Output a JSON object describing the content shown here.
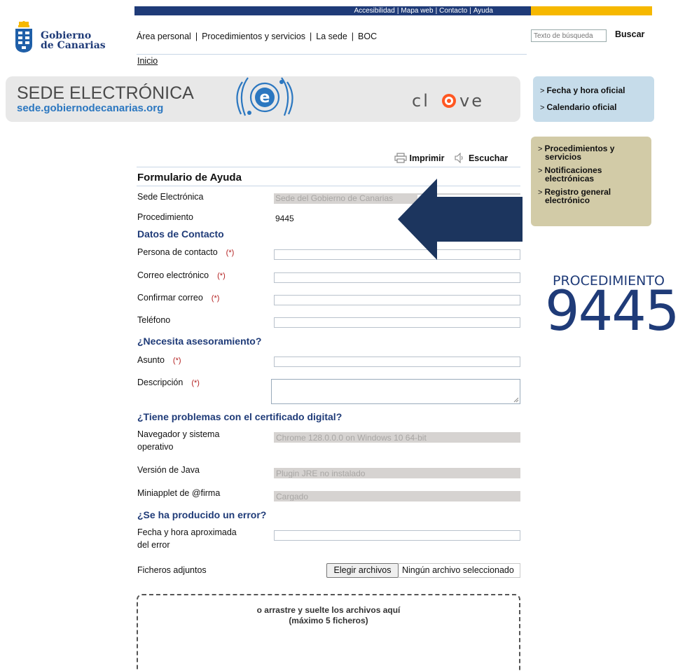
{
  "utility_bar": {
    "accesibilidad": "Accesibilidad",
    "mapa_web": "Mapa web",
    "contacto": "Contacto",
    "ayuda": "Ayuda",
    "separator": "|"
  },
  "logo": {
    "line1": "Gobierno",
    "line2": "de Canarias"
  },
  "nav": {
    "items": [
      "Área personal",
      "Procedimientos y servicios",
      "La sede",
      "BOC"
    ],
    "separator": "|",
    "breadcrumb": "Inicio"
  },
  "search": {
    "placeholder": "Texto de búsqueda",
    "button": "Buscar"
  },
  "banner": {
    "title": "SEDE ELECTRÓNICA",
    "url": "sede.gobiernodecanarias.org",
    "e_logo": "e",
    "clave_left": "cl",
    "clave_right": "ve"
  },
  "right_links_top": {
    "caret": ">",
    "items": [
      "Fecha y hora oficial",
      "Calendario oficial"
    ]
  },
  "right_links_bottom": {
    "caret": ">",
    "items": [
      [
        "Procedimientos y",
        "servicios"
      ],
      [
        "Notificaciones",
        "electrónicas"
      ],
      [
        "Registro general",
        "electrónico"
      ]
    ]
  },
  "tools": {
    "print": "Imprimir",
    "listen": "Escuchar"
  },
  "form": {
    "title": "Formulario de Ayuda",
    "required_mark": "(*)",
    "sede_label": "Sede Electrónica",
    "sede_value": "Sede del Gobierno de Canarias",
    "procedimiento_label": "Procedimiento",
    "procedimiento_value": "9445",
    "section_contacto": "Datos de Contacto",
    "persona_label": "Persona de contacto",
    "correo_label": "Correo electrónico",
    "confirmar_label": "Confirmar correo",
    "telefono_label": "Teléfono",
    "section_asesoramiento": "¿Necesita asesoramiento?",
    "asunto_label": "Asunto",
    "descripcion_label": "Descripción",
    "section_certificado": "¿Tiene problemas con el certificado digital?",
    "navegador_label_1": "Navegador y sistema",
    "navegador_label_2": "operativo",
    "navegador_value": "Chrome 128.0.0.0 on Windows 10 64-bit",
    "java_label": "Versión de Java",
    "java_value": "Plugin JRE no instalado",
    "miniapplet_label": "Miniapplet de @firma",
    "miniapplet_value": "Cargado",
    "section_error": "¿Se ha producido un error?",
    "fecha_label_1": "Fecha y hora aproximada",
    "fecha_label_2": "del error",
    "ficheros_label": "Ficheros adjuntos",
    "file_button": "Elegir archivos",
    "file_status": "Ningún archivo seleccionado",
    "drop_line1": "o arrastre y suelte los archivos aquí",
    "drop_line2": "(máximo 5 ficheros)"
  },
  "overlay": {
    "word": "PROCEDIMIENTO",
    "number": "9445",
    "color": "#1f3b78"
  },
  "colors": {
    "navy": "#1f3b78",
    "yellow": "#f6b800",
    "link_blue": "#2b77c0",
    "box_blue": "#c6dcea",
    "box_khaki": "#d2cba7",
    "required_red": "#b32020"
  }
}
